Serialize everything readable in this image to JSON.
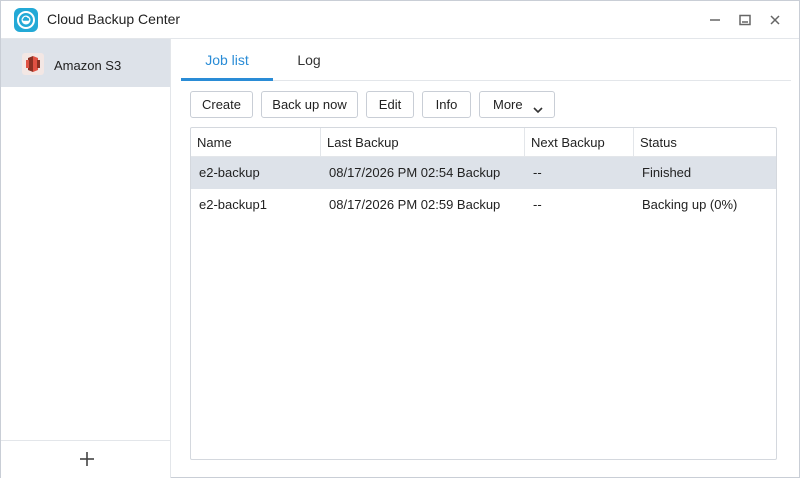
{
  "window": {
    "title": "Cloud Backup Center",
    "controls": {
      "minimize": "minimize-icon",
      "maximize": "maximize-icon",
      "close": "close-icon"
    }
  },
  "sidebar": {
    "items": [
      {
        "label": "Amazon S3",
        "icon": "amazon-s3-icon",
        "selected": true
      }
    ],
    "add_icon": "plus-icon"
  },
  "tabs": [
    {
      "label": "Job list",
      "active": true
    },
    {
      "label": "Log",
      "active": false
    }
  ],
  "toolbar": {
    "create_label": "Create",
    "backup_label": "Back up now",
    "edit_label": "Edit",
    "info_label": "Info",
    "more_label": "More"
  },
  "table": {
    "columns": [
      "Name",
      "Last Backup",
      "Next Backup",
      "Status"
    ],
    "rows": [
      {
        "name": "e2-backup",
        "last_backup": "08/17/2026 PM 02:54 Backup",
        "next_backup": "--",
        "status": "Finished",
        "selected": true
      },
      {
        "name": "e2-backup1",
        "last_backup": "08/17/2026 PM 02:59 Backup",
        "next_backup": "--",
        "status": "Backing up (0%)",
        "selected": false
      }
    ]
  },
  "colors": {
    "accent": "#2a8cd6",
    "selection": "#dde2e9",
    "app_icon": "#23a9d6"
  }
}
